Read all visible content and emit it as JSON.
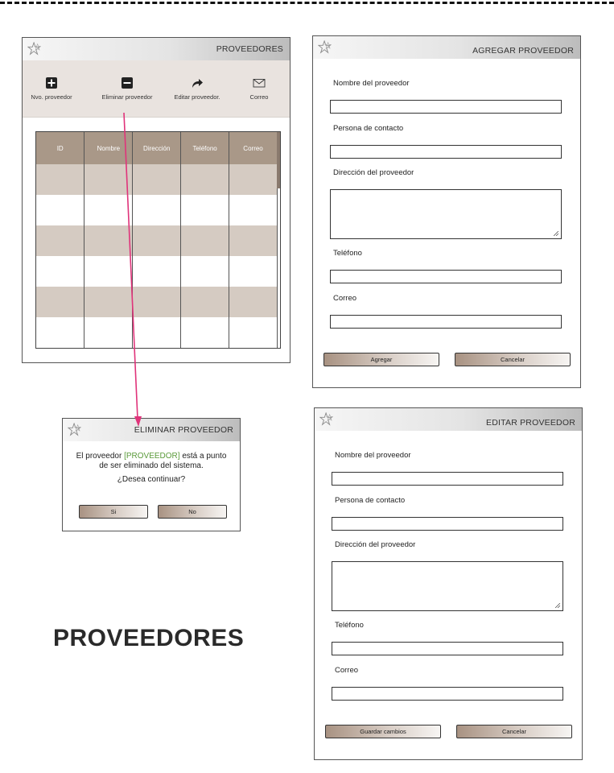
{
  "colors": {
    "accent": "#a99888",
    "row_alt": "#d5cbc2",
    "arrow": "#e0337a",
    "highlight": "#5a9a3a"
  },
  "proveedores_window": {
    "title": "PROVEEDORES",
    "toolbar": [
      {
        "label": "Nvo. proveedor",
        "icon": "plus-square-icon"
      },
      {
        "label": "Eliminar proveedor",
        "icon": "minus-square-icon"
      },
      {
        "label": "Editar proveedor.",
        "icon": "share-arrow-icon"
      },
      {
        "label": "Correo",
        "icon": "envelope-icon"
      }
    ],
    "columns": [
      "ID",
      "Nombre",
      "Dirección",
      "Teléfono",
      "Correo"
    ]
  },
  "agregar_window": {
    "title": "AGREGAR PROVEEDOR",
    "labels": {
      "nombre": "Nombre del proveedor",
      "contacto": "Persona de contacto",
      "direccion": "Dirección del proveedor",
      "telefono": "Teléfono",
      "correo": "Correo"
    },
    "buttons": {
      "primary": "Agregar",
      "cancel": "Cancelar"
    }
  },
  "eliminar_window": {
    "title": "ELIMINAR PROVEEDOR",
    "msg_prefix": "El proveedor ",
    "placeholder": "[PROVEEDOR]",
    "msg_suffix": " está a punto",
    "msg_line2": "de ser eliminado del sistema.",
    "question": "¿Desea continuar?",
    "buttons": {
      "yes": "Si",
      "no": "No"
    }
  },
  "editar_window": {
    "title": "EDITAR PROVEEDOR",
    "labels": {
      "nombre": "Nombre del proveedor",
      "contacto": "Persona de contacto",
      "direccion": "Dirección del proveedor",
      "telefono": "Teléfono",
      "correo": "Correo"
    },
    "buttons": {
      "primary": "Guardar cambios",
      "cancel": "Cancelar"
    }
  },
  "page_heading": "PROVEEDORES"
}
